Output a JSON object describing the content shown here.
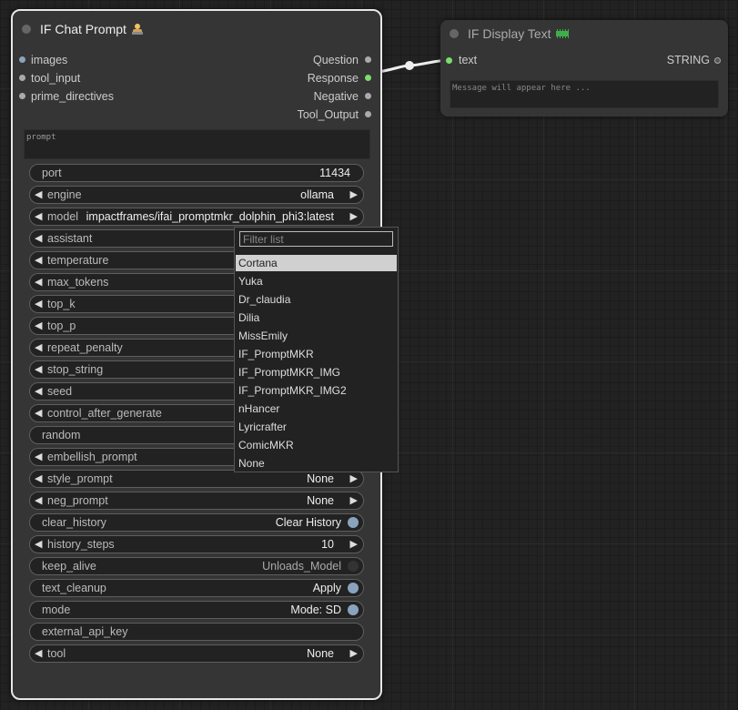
{
  "chat_node": {
    "title": "IF Chat Prompt",
    "title_icon": "person-emoji-icon",
    "inputs": [
      "images",
      "tool_input",
      "prime_directives"
    ],
    "outputs": [
      "Question",
      "Response",
      "Negative",
      "Tool_Output"
    ],
    "prompt_placeholder": "prompt",
    "widgets": [
      {
        "label": "port",
        "value": "11434",
        "kind": "text"
      },
      {
        "label": "engine",
        "value": "ollama",
        "kind": "combo"
      },
      {
        "label": "model",
        "value": "impactframes/ifai_promptmkr_dolphin_phi3:latest",
        "kind": "combo"
      },
      {
        "label": "assistant",
        "value": "",
        "kind": "combo"
      },
      {
        "label": "temperature",
        "value": "",
        "kind": "combo"
      },
      {
        "label": "max_tokens",
        "value": "",
        "kind": "combo"
      },
      {
        "label": "top_k",
        "value": "",
        "kind": "combo"
      },
      {
        "label": "top_p",
        "value": "",
        "kind": "combo"
      },
      {
        "label": "repeat_penalty",
        "value": "",
        "kind": "combo"
      },
      {
        "label": "stop_string",
        "value": "",
        "kind": "combo"
      },
      {
        "label": "seed",
        "value": "",
        "kind": "combo"
      },
      {
        "label": "control_after_generate",
        "value": "",
        "kind": "combo"
      },
      {
        "label": "random",
        "value": "",
        "kind": "text"
      },
      {
        "label": "embellish_prompt",
        "value": "",
        "kind": "combo"
      },
      {
        "label": "style_prompt",
        "value": "None",
        "kind": "combo"
      },
      {
        "label": "neg_prompt",
        "value": "None",
        "kind": "combo"
      },
      {
        "label": "clear_history",
        "value": "Clear History",
        "kind": "toggle",
        "on": true
      },
      {
        "label": "history_steps",
        "value": "10",
        "kind": "combo"
      },
      {
        "label": "keep_alive",
        "value": "Unloads_Model",
        "kind": "toggle",
        "on": false
      },
      {
        "label": "text_cleanup",
        "value": "Apply",
        "kind": "toggle",
        "on": true
      },
      {
        "label": "mode",
        "value": "Mode: SD",
        "kind": "toggle",
        "on": true
      },
      {
        "label": "external_api_key",
        "value": "",
        "kind": "text"
      },
      {
        "label": "tool",
        "value": "None",
        "kind": "combo"
      }
    ]
  },
  "display_node": {
    "title": "IF Display Text",
    "title_icon": "memory-chip-icon",
    "input": "text",
    "output": "STRING",
    "message_placeholder": "Message will appear here ..."
  },
  "dropdown": {
    "filter_placeholder": "Filter list",
    "selected_index": 0,
    "items": [
      "Cortana",
      "Yuka",
      "Dr_claudia",
      "Dilia",
      "MissEmily",
      "IF_PromptMKR",
      "IF_PromptMKR_IMG",
      "IF_PromptMKR_IMG2",
      "nHancer",
      "Lyricrafter",
      "ComicMKR",
      "None"
    ]
  },
  "colors": {
    "connected_slot": "#7ddc6e",
    "input_slot": "#8aa3bd",
    "toggle_on": "#8aa3bd"
  }
}
